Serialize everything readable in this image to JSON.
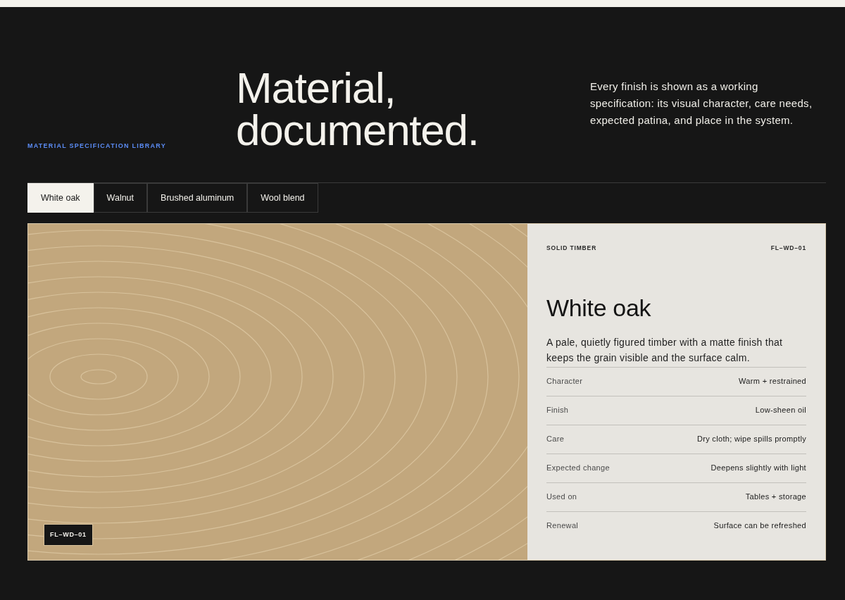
{
  "eyebrow": "MATERIAL SPECIFICATION LIBRARY",
  "title_lines": [
    "Material,",
    "documented."
  ],
  "intro": "Every finish is shown as a working specification: its visual character, care needs, expected patina, and place in the system.",
  "tabs": [
    {
      "label": "White oak",
      "selected": true
    },
    {
      "label": "Walnut",
      "selected": false
    },
    {
      "label": "Brushed aluminum",
      "selected": false
    },
    {
      "label": "Wool blend",
      "selected": false
    }
  ],
  "swatch": {
    "code_badge": "FL–WD–01"
  },
  "spec": {
    "category": "SOLID TIMBER",
    "code": "FL–WD–01",
    "name": "White oak",
    "description": "A pale, quietly figured timber with a matte finish that keeps the grain visible and the surface calm.",
    "rows": [
      {
        "label": "Character",
        "value": "Warm + restrained"
      },
      {
        "label": "Finish",
        "value": "Low-sheen oil"
      },
      {
        "label": "Care",
        "value": "Dry cloth; wipe spills promptly"
      },
      {
        "label": "Expected change",
        "value": "Deepens slightly with light"
      },
      {
        "label": "Used on",
        "value": "Tables + storage"
      },
      {
        "label": "Renewal",
        "value": "Surface can be refreshed"
      }
    ]
  }
}
